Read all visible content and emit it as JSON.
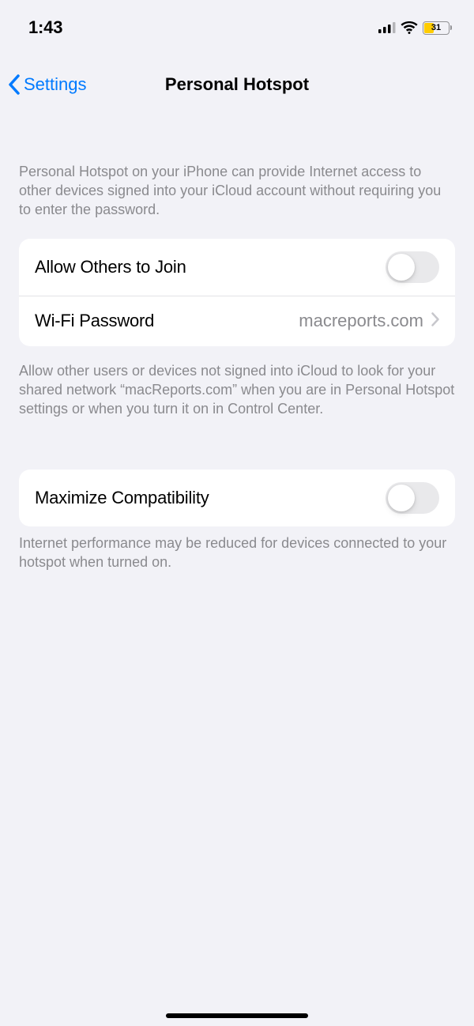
{
  "statusBar": {
    "time": "1:43",
    "batteryPct": "31"
  },
  "nav": {
    "backLabel": "Settings",
    "title": "Personal Hotspot"
  },
  "descriptions": {
    "intro": "Personal Hotspot on your iPhone can provide Internet access to other devices signed into your iCloud account without requiring you to enter the password.",
    "allowOthers": "Allow other users or devices not signed into iCloud to look for your shared network “macReports.com” when you are in Personal Hotspot settings or when you turn it on in Control Center.",
    "maxCompat": "Internet performance may be reduced for devices connected to your hotspot when turned on."
  },
  "rows": {
    "allowOthers": {
      "label": "Allow Others to Join",
      "on": false
    },
    "wifiPassword": {
      "label": "Wi-Fi Password",
      "value": "macreports.com"
    },
    "maxCompat": {
      "label": "Maximize Compatibility",
      "on": false
    }
  }
}
